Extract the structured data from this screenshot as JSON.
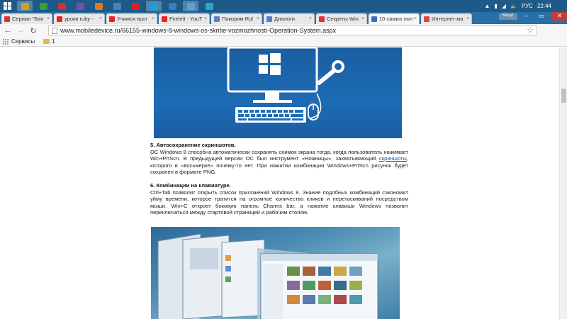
{
  "taskbar": {
    "apps": [
      {
        "name": "file-explorer-icon",
        "color": "#c9a227",
        "active": true
      },
      {
        "name": "chrome-icon",
        "color": "#3c9c3c",
        "active": false
      },
      {
        "name": "app-red-icon",
        "color": "#c33",
        "active": false
      },
      {
        "name": "visual-studio-icon",
        "color": "#7a4bb0",
        "active": false
      },
      {
        "name": "fl-studio-icon",
        "color": "#e07b1e",
        "active": false
      },
      {
        "name": "gom-player-icon",
        "color": "#4a7fc0",
        "active": false
      },
      {
        "name": "opera-icon",
        "color": "#d22",
        "active": false
      },
      {
        "name": "skype-icon",
        "color": "#1aa0e0",
        "active": true
      },
      {
        "name": "network-icon",
        "color": "#3a7cc0",
        "active": false
      },
      {
        "name": "paint-icon",
        "color": "#5fa0d8",
        "active": true
      },
      {
        "name": "z-app-icon",
        "color": "#2aa6c8",
        "active": false
      }
    ],
    "tray": {
      "language": "РУС",
      "time": "22:44"
    },
    "user": "Могут"
  },
  "tabs": [
    {
      "label": "Сериал \"Бан",
      "fav_color": "#d33"
    },
    {
      "label": "уроки ruby -",
      "fav_color": "#e22"
    },
    {
      "label": "Учимся прог",
      "fav_color": "#e22"
    },
    {
      "label": "Fireleit - YouT",
      "fav_color": "#e22"
    },
    {
      "label": "Покорим Rul",
      "fav_color": "#5a7fc0"
    },
    {
      "label": "Диалоги",
      "fav_color": "#5a7fc0"
    },
    {
      "label": "Секреты Win",
      "fav_color": "#d33"
    },
    {
      "label": "10 самых пол",
      "fav_color": "#3a6fc0",
      "active": true
    },
    {
      "label": "Интернет-ма",
      "fav_color": "#d44"
    }
  ],
  "toolbar": {
    "url": "www.mobiledevice.ru/66155-windows-8-windows-os-skritie-vozmozhnosti-Operation-System.aspx"
  },
  "bookmarks": {
    "apps_label": "Сервисы",
    "folder_label": "1"
  },
  "article": {
    "section5_title": "5. Автосохранение скриншотов.",
    "section5_text_a": "ОС Windows 8 способна автоматически сохранять снимок экрана тогда, когда пользователь нажимает Win+PrtScn. В предыдущей версии ОС был инструмент «Ножницы», захватывающий ",
    "section5_link": "скриншоты",
    "section5_text_b": ", которого в «восьмерке» почему-то нет. При нажатии комбинации Windows+PrtScn рисунок будет сохранен в формате PNG.",
    "section6_title": "6. Комбинации на клавиатуре.",
    "section6_text": "Ctrl+Tab позволит открыть список приложений Windows 8. Знание подобных комбинаций сэкономит уйму времени, которое тратится на огромное количество кликов и перетаскиваний посредством мыши.  Win+C откроет боковую панель Charms bar, а нажатие клавиши Windows позволит переключаться между стартовой страницей и рабочим столом."
  }
}
